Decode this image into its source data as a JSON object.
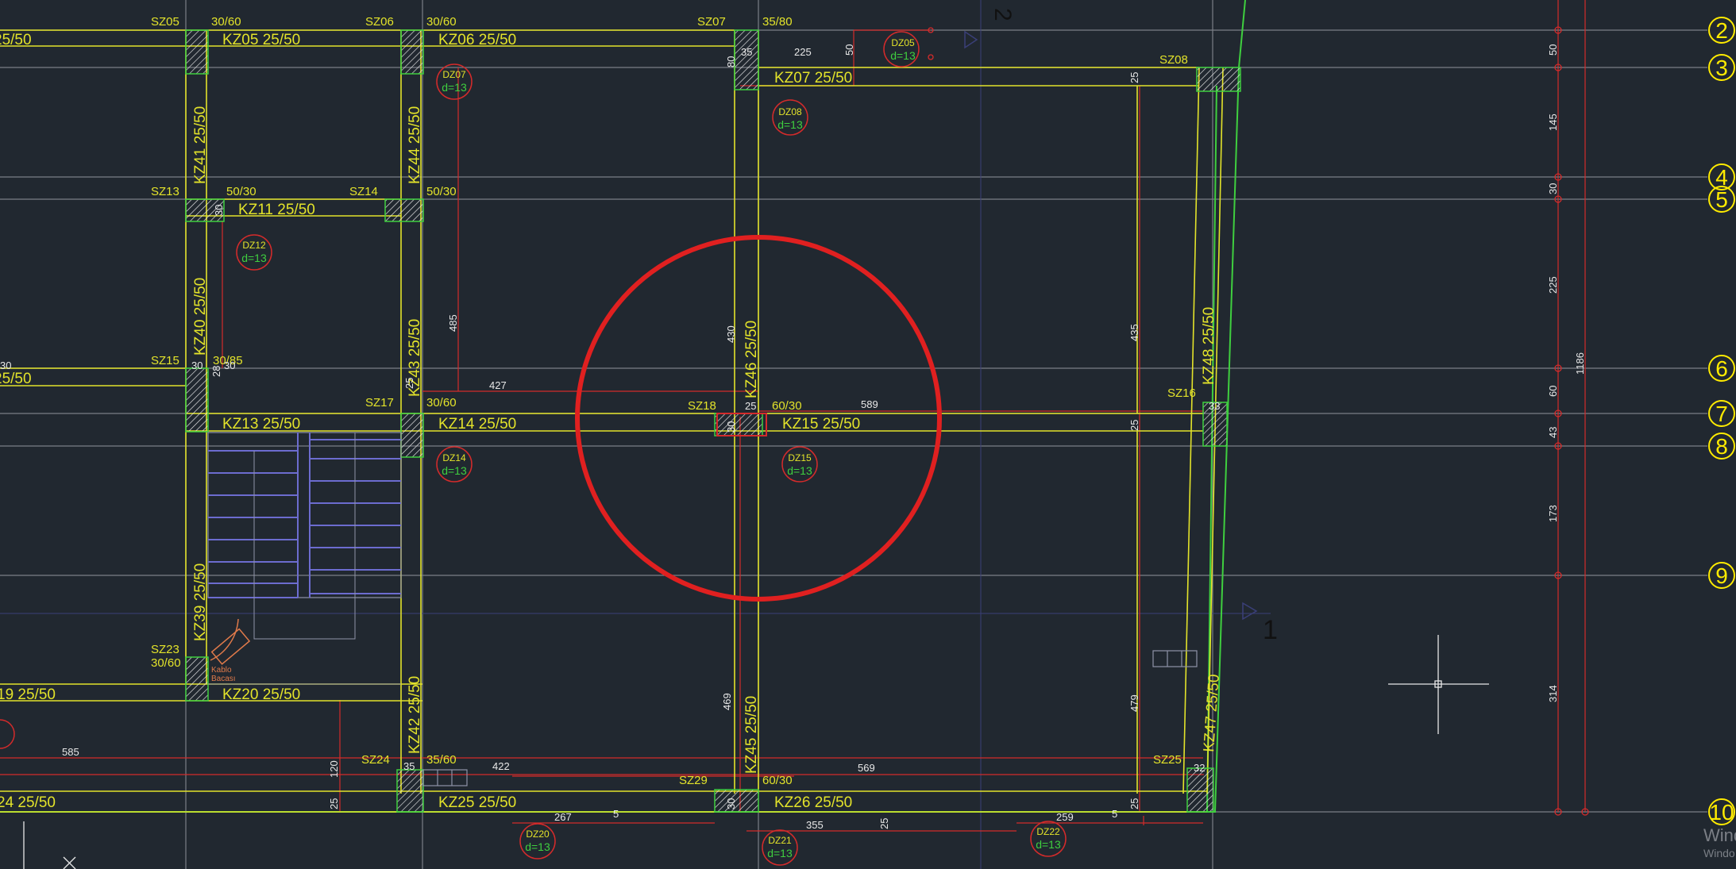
{
  "colors": {
    "background": "#212830",
    "beam": "#e3e32a",
    "grid": "#7b7f86",
    "dim": "#d42b2b",
    "green": "#3fcf3f",
    "blue": "#6c6ccf",
    "circle": "#e02020",
    "white": "#e8e8e8",
    "bubble": "#ffeb00"
  },
  "grid_axes": [
    "2",
    "3",
    "4",
    "5",
    "6",
    "7",
    "8",
    "9",
    "10"
  ],
  "top_labels": [
    "2",
    "1"
  ],
  "columns": [
    {
      "name": "SZ05",
      "size": "30/60"
    },
    {
      "name": "SZ06",
      "size": "30/60"
    },
    {
      "name": "SZ07",
      "size": "35/80"
    },
    {
      "name": "SZ08"
    },
    {
      "name": "SZ13",
      "size": "50/30"
    },
    {
      "name": "SZ14",
      "size": "50/30"
    },
    {
      "name": "SZ15",
      "size": "30/85"
    },
    {
      "name": "SZ16"
    },
    {
      "name": "SZ17",
      "size": "30/60"
    },
    {
      "name": "SZ18",
      "size": "60/30"
    },
    {
      "name": "SZ23",
      "size": "30/60"
    },
    {
      "name": "SZ24",
      "size": "35/60"
    },
    {
      "name": "SZ25"
    },
    {
      "name": "SZ29",
      "size": "60/30"
    }
  ],
  "beams": [
    "KZ05 25/50",
    "KZ06 25/50",
    "KZ07 25/50",
    "KZ11 25/50",
    "KZ13 25/50",
    "KZ14 25/50",
    "KZ15 25/50",
    "KZ20 25/50",
    "KZ25 25/50",
    "KZ26 25/50",
    "KZ41 25/50",
    "KZ44 25/50",
    "KZ40 25/50",
    "KZ43 25/50",
    "KZ46 25/50",
    "KZ48 25/50",
    "KZ39 25/50",
    "KZ42 25/50",
    "KZ45 25/50",
    "KZ47 25/50",
    "25/50",
    "25/50",
    "19 25/50",
    "24 25/50"
  ],
  "slabs": [
    {
      "name": "DZ05",
      "d": "d=13"
    },
    {
      "name": "DZ07",
      "d": "d=13"
    },
    {
      "name": "DZ08",
      "d": "d=13"
    },
    {
      "name": "DZ12",
      "d": "d=13"
    },
    {
      "name": "DZ14",
      "d": "d=13"
    },
    {
      "name": "DZ15",
      "d": "d=13"
    },
    {
      "name": "DZ20",
      "d": "d=13"
    },
    {
      "name": "DZ21",
      "d": "d=13"
    },
    {
      "name": "DZ22",
      "d": "d=13"
    }
  ],
  "dimensions": [
    "225",
    "50",
    "35",
    "80",
    "25",
    "485",
    "430",
    "435",
    "427",
    "589",
    "25",
    "33",
    "30",
    "30",
    "30",
    "585",
    "120",
    "25",
    "35",
    "422",
    "569",
    "32",
    "30",
    "25",
    "267",
    "5",
    "355",
    "25",
    "259",
    "5",
    "469",
    "479",
    "25",
    "30",
    "50",
    "145",
    "30",
    "225",
    "60",
    "43",
    "173",
    "314",
    "1186",
    "30",
    "28",
    "25"
  ],
  "stair_text": [
    "Kablo",
    "Bacası"
  ],
  "watermark": [
    "Wind",
    "Windo"
  ]
}
